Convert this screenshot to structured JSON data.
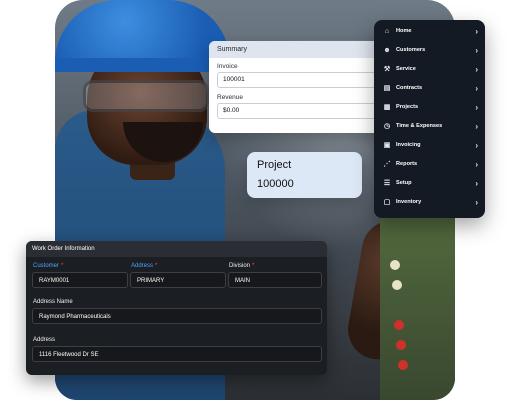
{
  "summary": {
    "title": "Summary",
    "invoice_label": "Invoice",
    "invoice_value": "100001",
    "revenue_label": "Revenue",
    "revenue_value": "$0.00"
  },
  "project": {
    "label": "Project",
    "value": "100000"
  },
  "nav": {
    "items": [
      {
        "label": "Home",
        "icon": "home-icon"
      },
      {
        "label": "Customers",
        "icon": "customers-icon"
      },
      {
        "label": "Service",
        "icon": "service-icon"
      },
      {
        "label": "Contracts",
        "icon": "contracts-icon"
      },
      {
        "label": "Projects",
        "icon": "projects-icon"
      },
      {
        "label": "Time & Expenses",
        "icon": "time-expenses-icon"
      },
      {
        "label": "Invoicing",
        "icon": "invoicing-icon"
      },
      {
        "label": "Reports",
        "icon": "reports-icon"
      },
      {
        "label": "Setup",
        "icon": "setup-icon"
      },
      {
        "label": "Inventory",
        "icon": "inventory-icon"
      }
    ]
  },
  "work_order": {
    "title": "Work Order Information",
    "customer_label": "Customer",
    "customer_value": "RAYM0001",
    "address_label": "Address",
    "address_value": "PRIMARY",
    "division_label": "Division",
    "division_value": "MAIN",
    "address_name_label": "Address Name",
    "address_name_value": "Raymond Pharmaceuticals",
    "street_label": "Address",
    "street_value": "1116 Fleetwood Dr SE"
  },
  "colors": {
    "nav_bg": "#141a24",
    "accent_blue": "#4ea4ff",
    "required_red": "#ff4d4d",
    "project_card": "#dce8f6"
  }
}
